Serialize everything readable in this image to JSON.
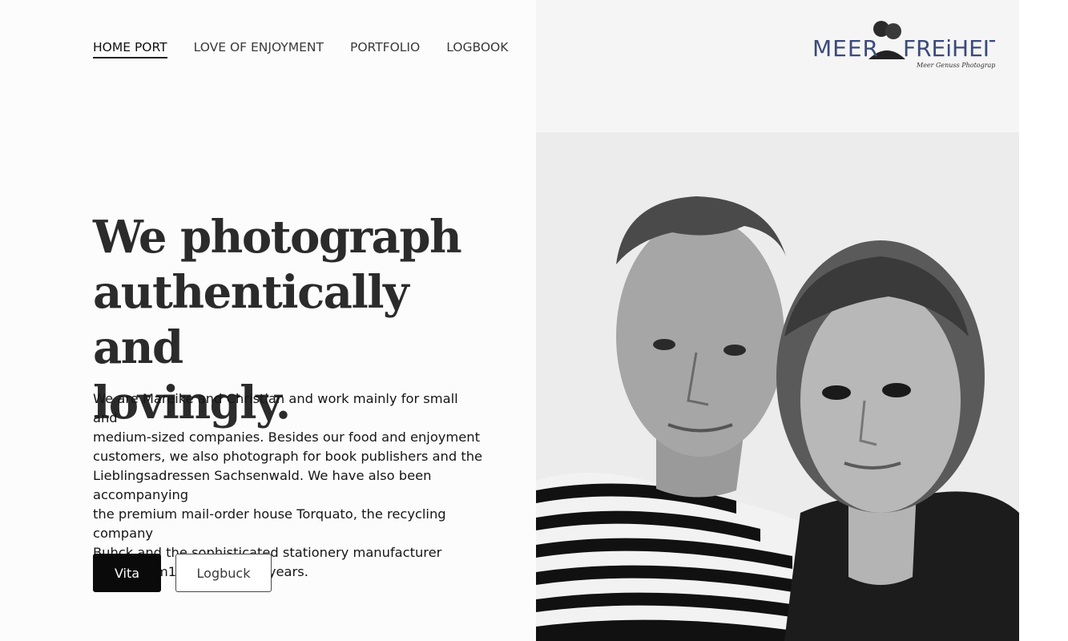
{
  "nav": {
    "items": [
      {
        "label": "HOME PORT",
        "active": true
      },
      {
        "label": "LOVE OF ENJOYMENT",
        "active": false
      },
      {
        "label": "PORTFOLIO",
        "active": false
      },
      {
        "label": "LOGBOOK",
        "active": false
      }
    ]
  },
  "logo": {
    "text_left": "MEER",
    "text_right": "FREiHEIT",
    "tagline": "Meer Genuss Photography",
    "color": "#3b4a7a"
  },
  "hero": {
    "headline_lines": [
      "We photograph",
      "authentically and",
      "lovingly."
    ],
    "intro_lines": [
      "We are Mareike and Christian and work mainly for small and",
      "medium-sized companies. Besides our food and enjoyment",
      "customers, we also photograph for book publishers and the",
      "Lieblingsadressen Sachsenwald. We have also been accompanying",
      "the premium mail-order house Torquato, the recycling company",
      "Buhck and the sophisticated stationery manufacturer",
      "Leuchtturm1917 for many years."
    ]
  },
  "buttons": {
    "primary_label": "Vita",
    "secondary_label": "Logbuck"
  },
  "colors": {
    "primary_button": "#0a0a0a",
    "text": "#1f1f1f",
    "logo_blue": "#3b4a7a"
  }
}
